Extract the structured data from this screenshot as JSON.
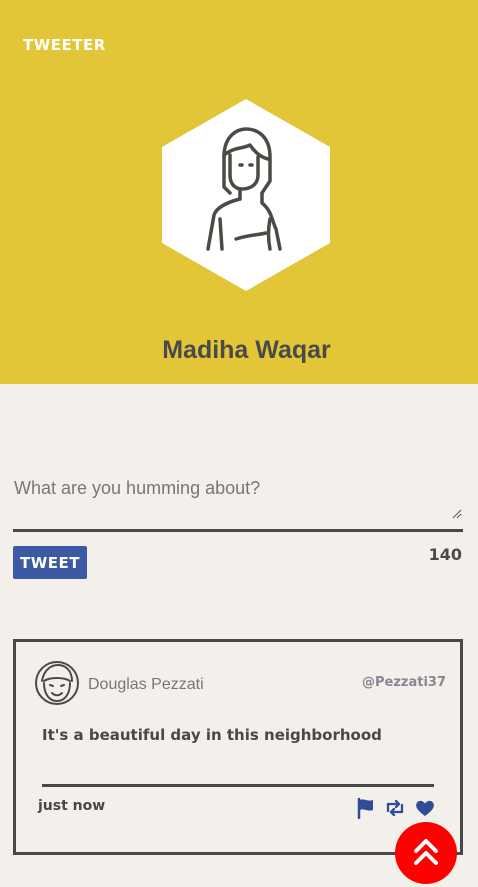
{
  "app": {
    "brand": "TWEETER"
  },
  "profile": {
    "name": "Madiha Waqar",
    "avatar_icon": "woman-avatar-icon",
    "header_color": "#e3c637"
  },
  "composer": {
    "placeholder": "What are you humming about?",
    "value": "",
    "button_label": "TWEET",
    "char_count": "140",
    "button_color": "#3b5aa3"
  },
  "tweets": [
    {
      "author": "Douglas Pezzati",
      "handle": "@Pezzati37",
      "text": "It's a beautiful day in this neighborhood",
      "time": "just now",
      "avatar_icon": "man-avatar-icon",
      "actions": [
        "flag-icon",
        "retweet-icon",
        "heart-icon"
      ]
    }
  ],
  "scroll_top": {
    "icon": "double-chevron-up-icon",
    "color": "#ff0000"
  }
}
